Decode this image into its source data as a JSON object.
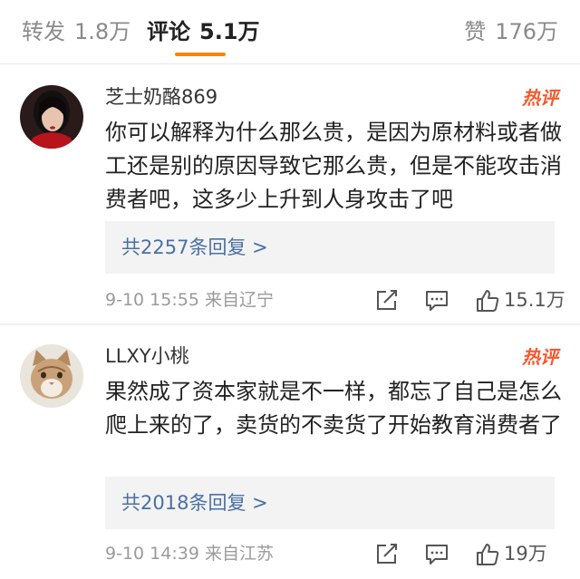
{
  "tabs": {
    "repost": {
      "label": "转发",
      "count": "1.8万"
    },
    "comment": {
      "label": "评论",
      "count": "5.1万"
    },
    "like": {
      "label": "赞",
      "count": "176万"
    }
  },
  "colors": {
    "accent": "#ff8200",
    "hot": "#f5592c",
    "link": "#4a6fa5",
    "meta": "#9a9a9a"
  },
  "comments": [
    {
      "username": "芝士奶酪869",
      "badge": "热评",
      "text": "你可以解释为什么那么贵，是因为原材料或者做工还是别的原因导致它那么贵，但是不能攻击消费者吧，这多少上升到人身攻击了吧",
      "replies_label": "共2257条回复 >",
      "time": "9-10 15:55",
      "location": "来自辽宁",
      "likes": "15.1万",
      "icons": [
        "share-icon",
        "reply-icon",
        "like-icon"
      ]
    },
    {
      "username": "LLXY小桃",
      "badge": "热评",
      "text": "果然成了资本家就是不一样，都忘了自己是怎么爬上来的了，卖货的不卖货了开始教育消费者了",
      "replies_label": "共2018条回复 >",
      "time": "9-10 14:39",
      "location": "来自江苏",
      "likes": "19万",
      "icons": [
        "share-icon",
        "reply-icon",
        "like-icon"
      ]
    }
  ]
}
